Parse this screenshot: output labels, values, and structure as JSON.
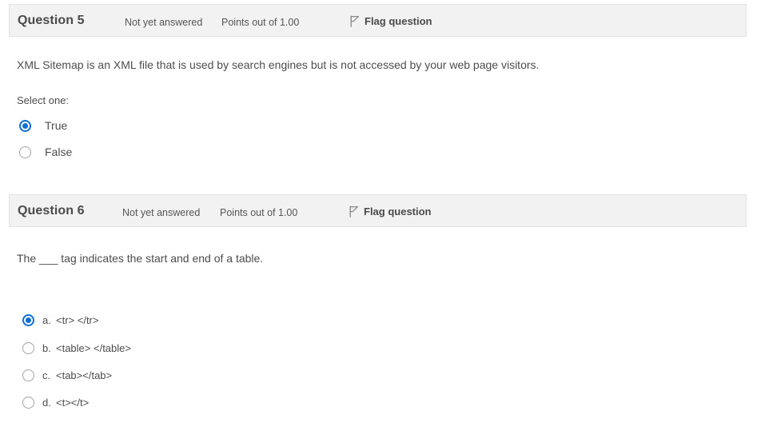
{
  "questions": [
    {
      "number_label": "Question 5",
      "state": "Not yet answered",
      "grade": "Points out of 1.00",
      "flag_label": "Flag question",
      "flag_icon": "flag-icon",
      "text": "XML Sitemap is an XML file that is used by search engines but is not accessed by your web page visitors.",
      "select_prompt": "Select one:",
      "answers": [
        {
          "key": "",
          "text": "True",
          "selected": true
        },
        {
          "key": "",
          "text": "False",
          "selected": false
        }
      ]
    },
    {
      "number_label": "Question 6",
      "state": "Not yet answered",
      "grade": "Points out of 1.00",
      "flag_label": "Flag question",
      "flag_icon": "flag-icon",
      "text": "The ___ tag indicates the start and end of a table.",
      "select_prompt": "",
      "answers": [
        {
          "key": "a.",
          "text": "<tr> </tr>",
          "selected": true
        },
        {
          "key": "b.",
          "text": "<table> </table>",
          "selected": false
        },
        {
          "key": "c.",
          "text": "<tab></tab>",
          "selected": false
        },
        {
          "key": "d.",
          "text": "<t></t>",
          "selected": false
        }
      ]
    }
  ],
  "colors": {
    "header_bg": "#f2f2f2",
    "header_border": "#e3e3e3",
    "accent_blue": "#0b6fd4",
    "text": "#4d4d4d",
    "radio_off": "#a3a3a8"
  }
}
